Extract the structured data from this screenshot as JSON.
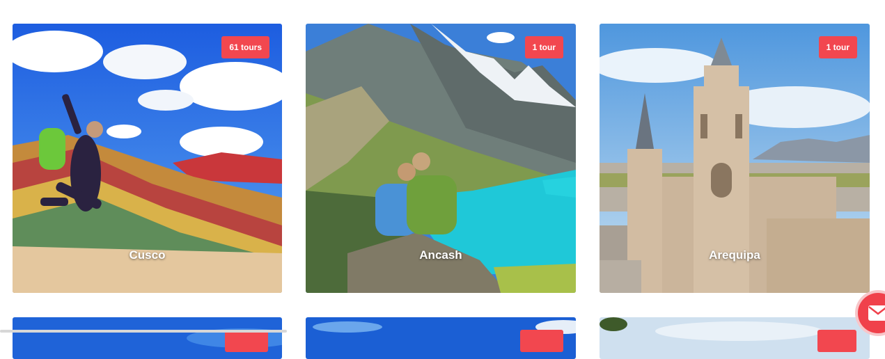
{
  "destinations": [
    {
      "name": "Cusco",
      "badge": "61 tours"
    },
    {
      "name": "Ancash",
      "badge": "1 tour"
    },
    {
      "name": "Arequipa",
      "badge": "1 tour"
    }
  ],
  "colors": {
    "badge": "#f2474f",
    "mail_button": "#f0414b"
  },
  "icons": {
    "chat": "envelope-icon"
  }
}
